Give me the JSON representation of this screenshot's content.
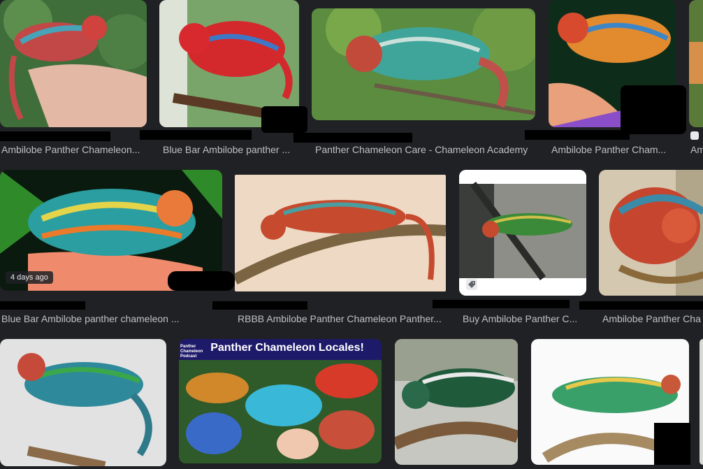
{
  "results": [
    {
      "caption": "Ambilobe Panther Chameleon..."
    },
    {
      "caption": "Blue Bar Ambilobe panther ..."
    },
    {
      "caption": "Panther Chameleon Care - Chameleon Academy"
    },
    {
      "caption": "Ambilobe Panther Cham..."
    },
    {
      "caption": "Am"
    },
    {
      "caption": "Blue Bar Ambilobe panther chameleon ...",
      "badge": "4 days ago"
    },
    {
      "caption": "RBBB Ambilobe Panther Chameleon Panther..."
    },
    {
      "caption": "Buy Ambilobe Panther C..."
    },
    {
      "caption": "Ambilobe Panther Cha"
    },
    {
      "caption": ""
    },
    {
      "caption": "",
      "promo_title": "Panther Chameleon Locales!",
      "logo_text": "Panther Chameleon Podcast"
    },
    {
      "caption": ""
    },
    {
      "caption": ""
    }
  ],
  "colors": {
    "background": "#202124",
    "caption": "#bdc1c6"
  }
}
